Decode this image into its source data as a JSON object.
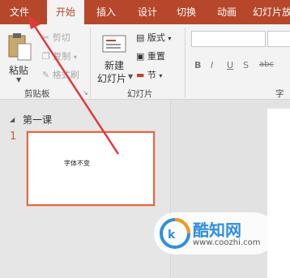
{
  "tabs": [
    "文件",
    "开始",
    "插入",
    "设计",
    "切换",
    "动画",
    "幻灯片放"
  ],
  "clipboard": {
    "paste": "粘贴",
    "cut": "剪切",
    "copy": "复制",
    "format_painter": "格式刷",
    "group": "剪贴板"
  },
  "slides_group": {
    "new_slide_line1": "新建",
    "new_slide_line2": "幻灯片",
    "layout": "版式",
    "reset": "重置",
    "section": "节",
    "group": "幻灯片"
  },
  "font_group": {
    "group": "字体",
    "bold": "B",
    "italic": "I",
    "underline": "U",
    "shadow": "S",
    "strike": "abc"
  },
  "panel": {
    "section_title": "第一课",
    "slide_number": "1",
    "slide_text": "字体不变"
  },
  "watermark": {
    "brand": "酷知网",
    "url": "www.coozhi.com"
  }
}
